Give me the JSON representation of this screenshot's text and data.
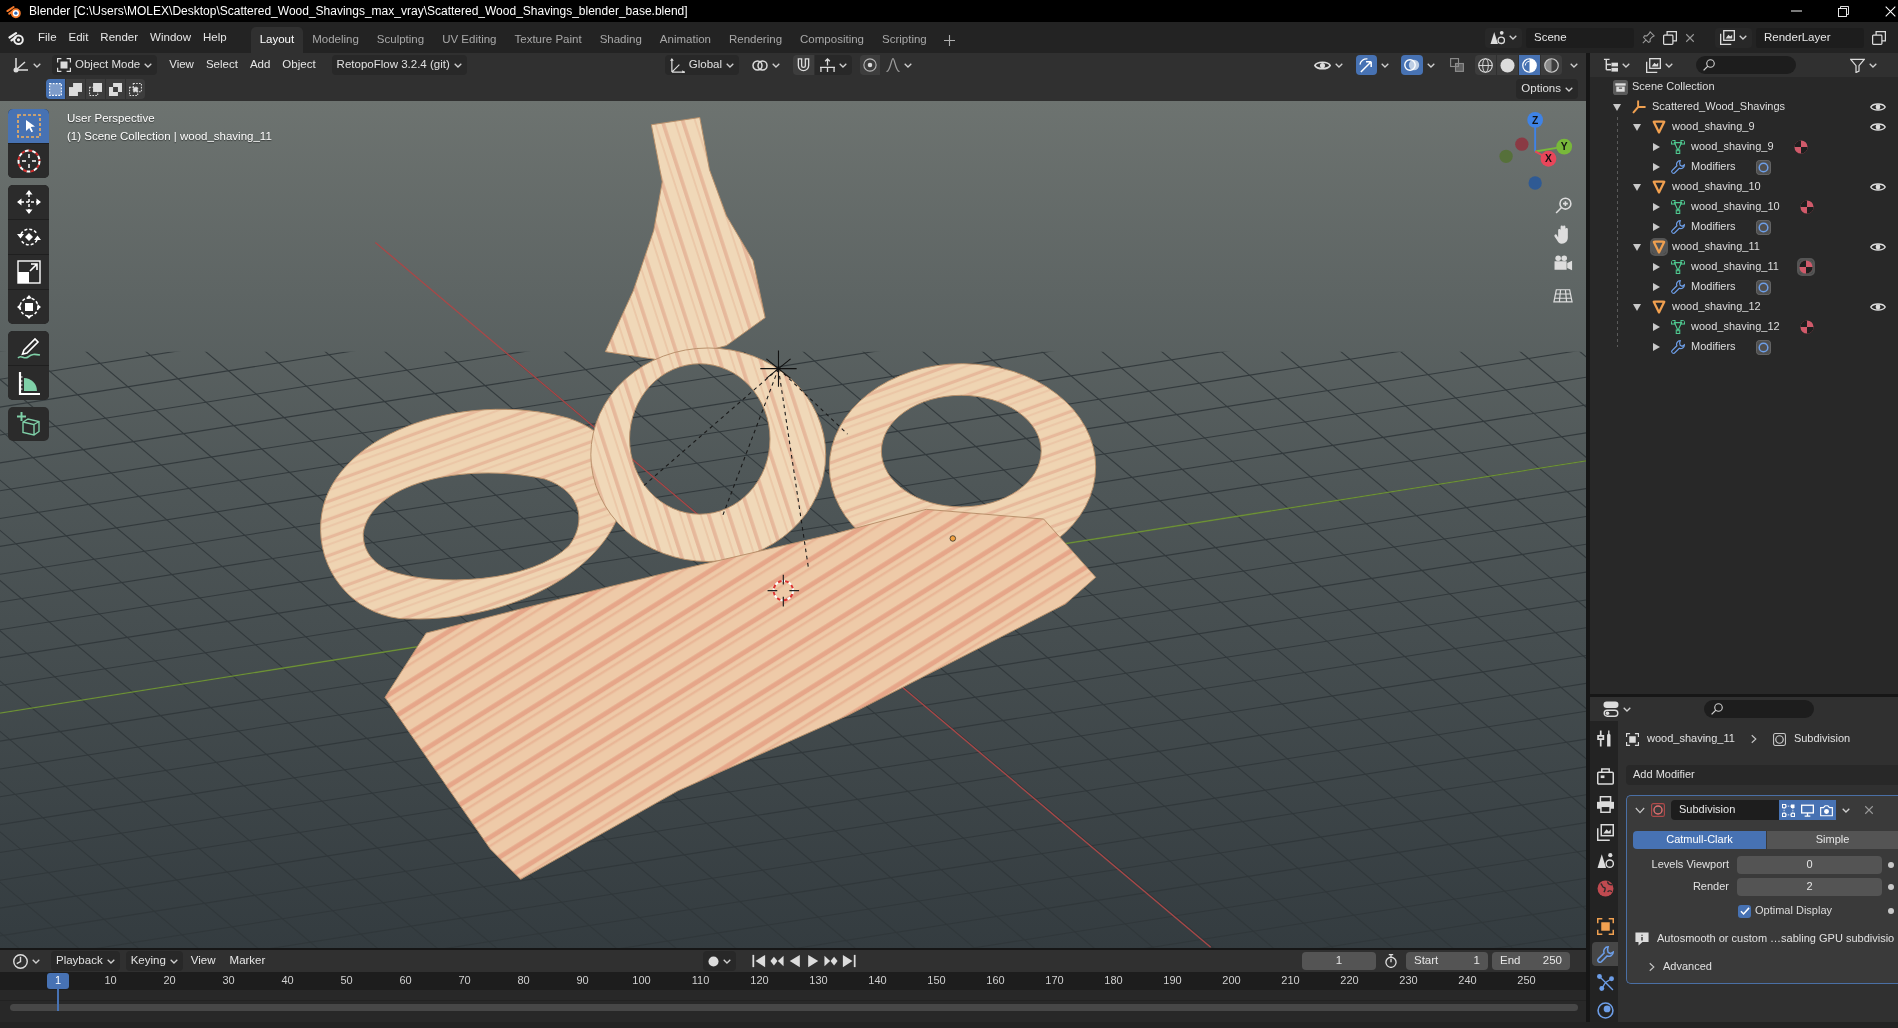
{
  "window": {
    "title": "Blender [C:\\Users\\MOLEX\\Desktop\\Scattered_Wood_Shavings_max_vray\\Scattered_Wood_Shavings_blender_base.blend]"
  },
  "top_menu": [
    "File",
    "Edit",
    "Render",
    "Window",
    "Help"
  ],
  "workspace_tabs": [
    {
      "label": "Layout",
      "selected": true
    },
    {
      "label": "Modeling",
      "selected": false
    },
    {
      "label": "Sculpting",
      "selected": false
    },
    {
      "label": "UV Editing",
      "selected": false
    },
    {
      "label": "Texture Paint",
      "selected": false
    },
    {
      "label": "Shading",
      "selected": false
    },
    {
      "label": "Animation",
      "selected": false
    },
    {
      "label": "Rendering",
      "selected": false
    },
    {
      "label": "Compositing",
      "selected": false
    },
    {
      "label": "Scripting",
      "selected": false
    }
  ],
  "scene": {
    "name": "Scene",
    "view_layer": "RenderLayer"
  },
  "viewport_header": {
    "mode": "Object Mode",
    "menus": [
      "View",
      "Select",
      "Add",
      "Object"
    ],
    "addon_menu": "RetopoFlow 3.2.4 (git)",
    "orientation": "Global",
    "gizmos_on": true,
    "overlays_on": true,
    "xray_on": false,
    "shading_modes": [
      {
        "kind": "wireframe",
        "selected": false
      },
      {
        "kind": "solid",
        "selected": false
      },
      {
        "kind": "material",
        "selected": true
      },
      {
        "kind": "rendered",
        "selected": false
      }
    ]
  },
  "tool_settings": {
    "select_modes": [
      {
        "kind": "set",
        "selected": true
      },
      {
        "kind": "extend",
        "selected": false
      },
      {
        "kind": "subtract",
        "selected": false
      },
      {
        "kind": "invert",
        "selected": false
      },
      {
        "kind": "intersect",
        "selected": false
      }
    ],
    "options": "Options"
  },
  "toolbar": [
    [
      {
        "kind": "select_box",
        "selected": true
      },
      {
        "kind": "cursor",
        "selected": false
      }
    ],
    [
      {
        "kind": "move",
        "selected": false
      },
      {
        "kind": "rotate",
        "selected": false
      },
      {
        "kind": "scale",
        "selected": false
      },
      {
        "kind": "transform",
        "selected": false
      }
    ],
    [
      {
        "kind": "annotate",
        "selected": false
      },
      {
        "kind": "measure",
        "selected": false
      }
    ],
    [
      {
        "kind": "add_cube",
        "selected": false
      }
    ]
  ],
  "viewport": {
    "view_name": "User Perspective",
    "collection_info": "(1) Scene Collection | wood_shaving_11",
    "axes": [
      {
        "kind": "z",
        "label": "Z"
      },
      {
        "kind": "y",
        "label": "Y"
      },
      {
        "kind": "x",
        "label": "X"
      }
    ]
  },
  "outliner": {
    "root": "Scene Collection",
    "tree": [
      {
        "label": "Scattered_Wood_Shavings",
        "kind": "empty",
        "expanded": true,
        "children": [
          {
            "label": "wood_shaving_9",
            "kind": "object",
            "expanded": true,
            "active": false,
            "children": [
              {
                "label": "wood_shaving_9",
                "kind": "mesh",
                "expanded": false
              },
              {
                "label": "Modifiers",
                "kind": "modifiers",
                "expanded": false
              }
            ]
          },
          {
            "label": "wood_shaving_10",
            "kind": "object",
            "expanded": true,
            "active": false,
            "children": [
              {
                "label": "wood_shaving_10",
                "kind": "mesh",
                "expanded": false
              },
              {
                "label": "Modifiers",
                "kind": "modifiers",
                "expanded": false
              }
            ]
          },
          {
            "label": "wood_shaving_11",
            "kind": "object",
            "expanded": true,
            "active": true,
            "children": [
              {
                "label": "wood_shaving_11",
                "kind": "mesh",
                "expanded": false
              },
              {
                "label": "Modifiers",
                "kind": "modifiers",
                "expanded": false
              }
            ]
          },
          {
            "label": "wood_shaving_12",
            "kind": "object",
            "expanded": true,
            "active": false,
            "children": [
              {
                "label": "wood_shaving_12",
                "kind": "mesh",
                "expanded": false
              },
              {
                "label": "Modifiers",
                "kind": "modifiers",
                "expanded": false
              }
            ]
          }
        ]
      }
    ]
  },
  "properties": {
    "tabs": [
      [
        {
          "kind": "tool",
          "selected": false
        }
      ],
      [
        {
          "kind": "render",
          "selected": false
        },
        {
          "kind": "output",
          "selected": false
        },
        {
          "kind": "view_layer",
          "selected": false
        },
        {
          "kind": "scene",
          "selected": false
        },
        {
          "kind": "world",
          "selected": false
        }
      ],
      [
        {
          "kind": "object",
          "selected": false
        },
        {
          "kind": "modifiers",
          "selected": true
        },
        {
          "kind": "particles",
          "selected": false
        },
        {
          "kind": "physics",
          "selected": false
        }
      ]
    ],
    "breadcrumb": [
      "wood_shaving_11",
      "Subdivision"
    ],
    "add_modifier": "Add Modifier",
    "modifier": {
      "name": "Subdivision",
      "expanded": true,
      "edit_mode": true,
      "viewport": true,
      "render": true,
      "methods": [
        {
          "label": "Catmull-Clark",
          "selected": true
        },
        {
          "label": "Simple",
          "selected": false
        }
      ],
      "fields": [
        {
          "label": "Levels Viewport",
          "value": "0"
        },
        {
          "label": "Render",
          "value": "2"
        }
      ],
      "optimal_display": {
        "label": "Optimal Display",
        "checked": true
      },
      "info": "Autosmooth or custom …sabling GPU subdivisio",
      "advanced": {
        "label": "Advanced",
        "expanded": false
      }
    }
  },
  "timeline": {
    "menus": [
      "Playback",
      "Keying",
      "View",
      "Marker"
    ],
    "current_frame": "1",
    "start_label": "Start",
    "start": "1",
    "end_label": "End",
    "end": "250",
    "playhead": "1",
    "ruler": [
      "10",
      "20",
      "30",
      "40",
      "50",
      "60",
      "70",
      "80",
      "90",
      "100",
      "110",
      "120",
      "130",
      "140",
      "150",
      "160",
      "170",
      "180",
      "190",
      "200",
      "210",
      "220",
      "230",
      "240",
      "250"
    ]
  }
}
